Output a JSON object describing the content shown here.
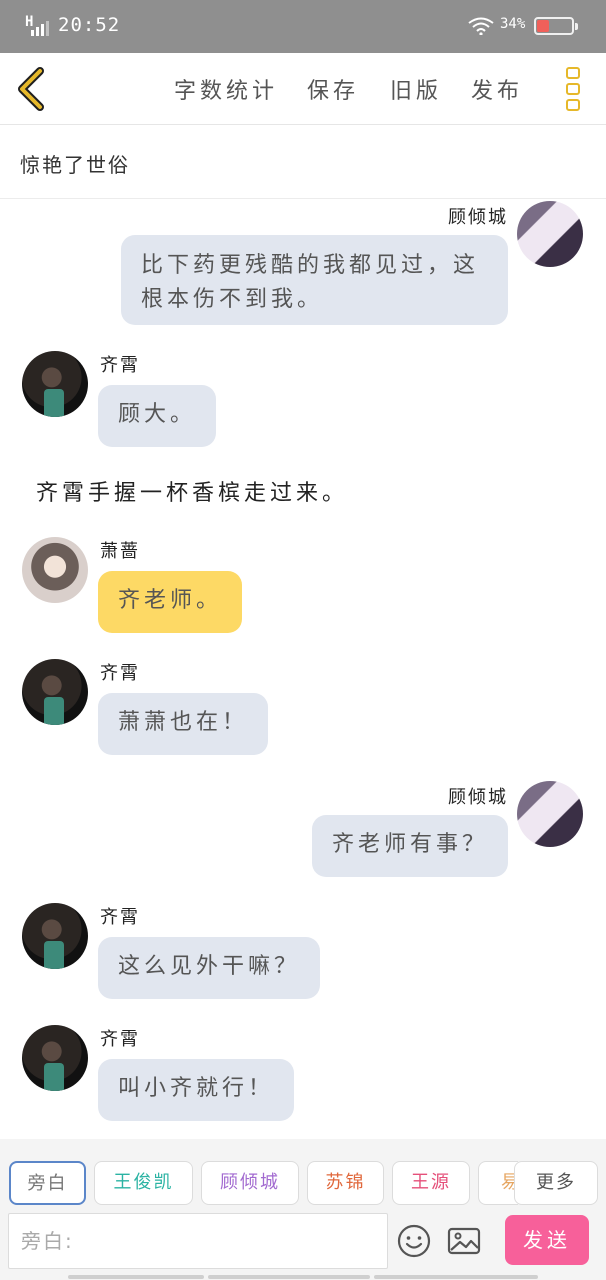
{
  "status_bar": {
    "network": "H",
    "time": "20:52",
    "battery_pct": "34",
    "battery_color": "#f0605a"
  },
  "header": {
    "actions": [
      "字数统计",
      "保存",
      "旧版",
      "发布"
    ],
    "accent_color": "#e6b82a"
  },
  "story_title": "惊艳了世俗",
  "messages": [
    {
      "side": "right",
      "sender": "顾倾城",
      "text": "比下药更残酷的我都见过，这根本伤不到我。"
    },
    {
      "side": "left",
      "sender": "齐霄",
      "text": "顾大。"
    },
    {
      "type": "narration",
      "text": "齐霄手握一杯香槟走过来。"
    },
    {
      "side": "left",
      "sender": "萧蔷",
      "text": "齐老师。",
      "bubble_color": "#fdd965"
    },
    {
      "side": "left",
      "sender": "齐霄",
      "text": "萧萧也在！"
    },
    {
      "side": "right",
      "sender": "顾倾城",
      "text": "齐老师有事？"
    },
    {
      "side": "left",
      "sender": "齐霄",
      "text": "这么见外干嘛？"
    },
    {
      "side": "left",
      "sender": "齐霄",
      "text": "叫小齐就行！"
    }
  ],
  "characters": [
    {
      "name": "旁白",
      "color": "#777777"
    },
    {
      "name": "王俊凯",
      "color": "#2bb3a3"
    },
    {
      "name": "顾倾城",
      "color": "#a26ad0"
    },
    {
      "name": "苏锦",
      "color": "#e0683c"
    },
    {
      "name": "王源",
      "color": "#e5507a"
    },
    {
      "name": "易",
      "color": "#e6a560"
    }
  ],
  "more_label": "更多",
  "input": {
    "placeholder": "旁白:"
  },
  "send_label": "发送",
  "send_color": "#f7609a"
}
